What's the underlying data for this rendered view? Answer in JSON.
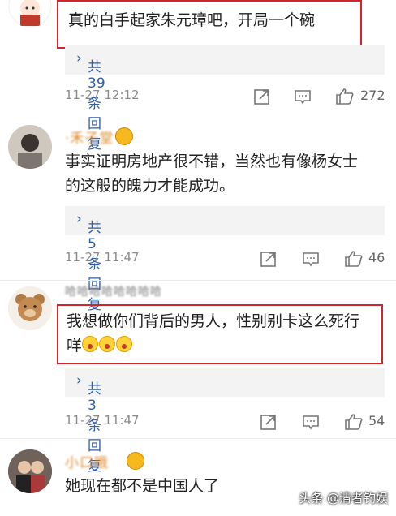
{
  "comments": [
    {
      "username": "",
      "text": "真的白手起家朱元璋吧，开局一个碗",
      "replies": "共39条回复",
      "time": "11-27 12:12",
      "likes": "272"
    },
    {
      "username": "·禾子堂",
      "text1": "事实证明房地产很不错，当然也有像杨女士",
      "text2": "的这般的魄力才能成功。",
      "replies": "共5条回复",
      "time": "11-27 11:47",
      "likes": "46"
    },
    {
      "username": "哈哈哈哈哈哈哈哈",
      "text1": "我想做你们背后的男人，性别别卡这么死行",
      "text2": "咩",
      "replies": "共3条回复",
      "time": "11-27 11:47",
      "likes": "54"
    },
    {
      "username": "小口哦",
      "text": "她现在都不是中国人了"
    }
  ],
  "watermark": "头条 @清者钓娱",
  "icons": [
    "share-icon",
    "comment-icon",
    "thumbs-up-icon"
  ],
  "colors": {
    "highlight_box": "#d3242c",
    "reply_link": "#2f5ea8",
    "username": "#e08a2a"
  }
}
